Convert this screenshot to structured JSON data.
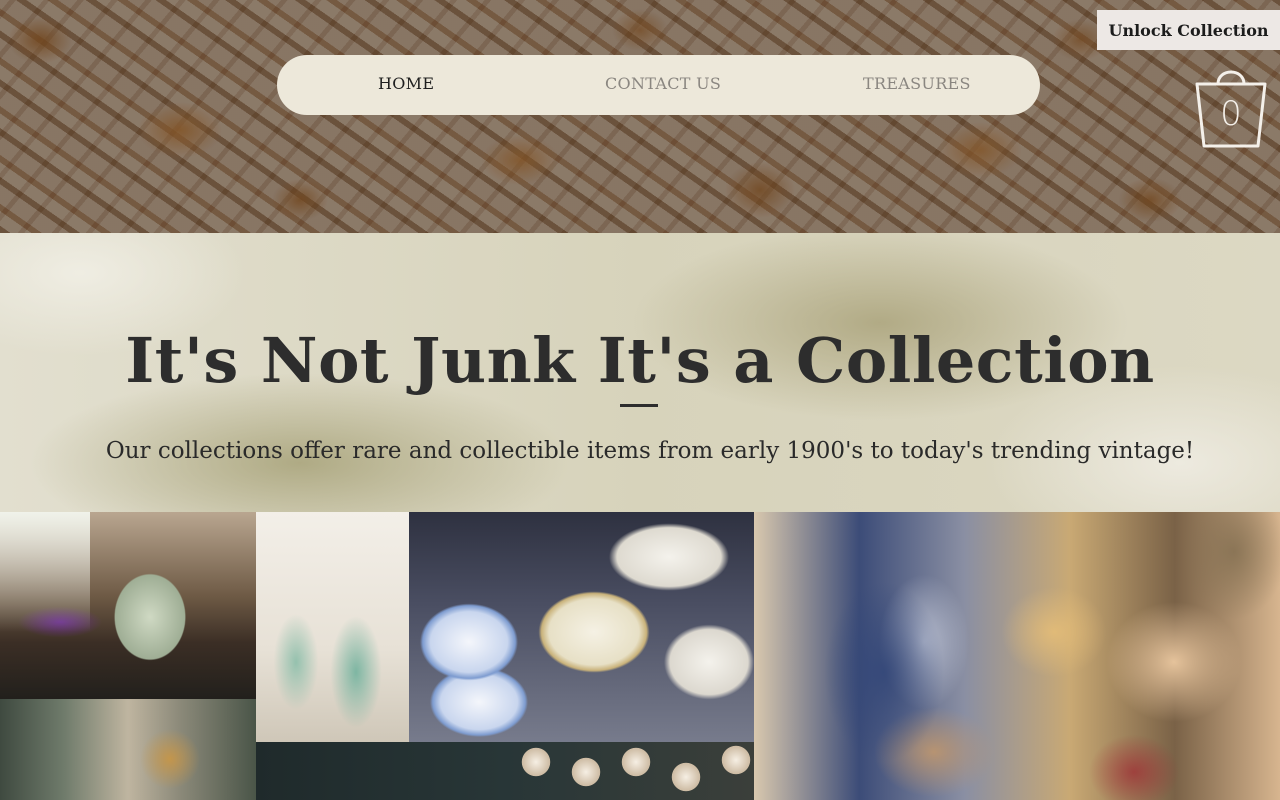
{
  "header": {
    "nav": [
      {
        "label": "HOME",
        "active": true
      },
      {
        "label": "CONTACT US",
        "active": false
      },
      {
        "label": "TREASURES",
        "active": false
      }
    ],
    "unlock_label": "Unlock Collection",
    "cart_count": "0",
    "cart_icon": "shopping-bag-icon"
  },
  "hero": {
    "title": "It's Not Junk It's a Collection",
    "subtitle": "Our collections offer rare and collectible items from early 1900's to today's trending vintage!"
  },
  "colors": {
    "nav_bg": "#ede8da",
    "nav_active": "#1f1f1f",
    "nav_inactive": "#8a8680",
    "title": "#2d2d2d"
  }
}
